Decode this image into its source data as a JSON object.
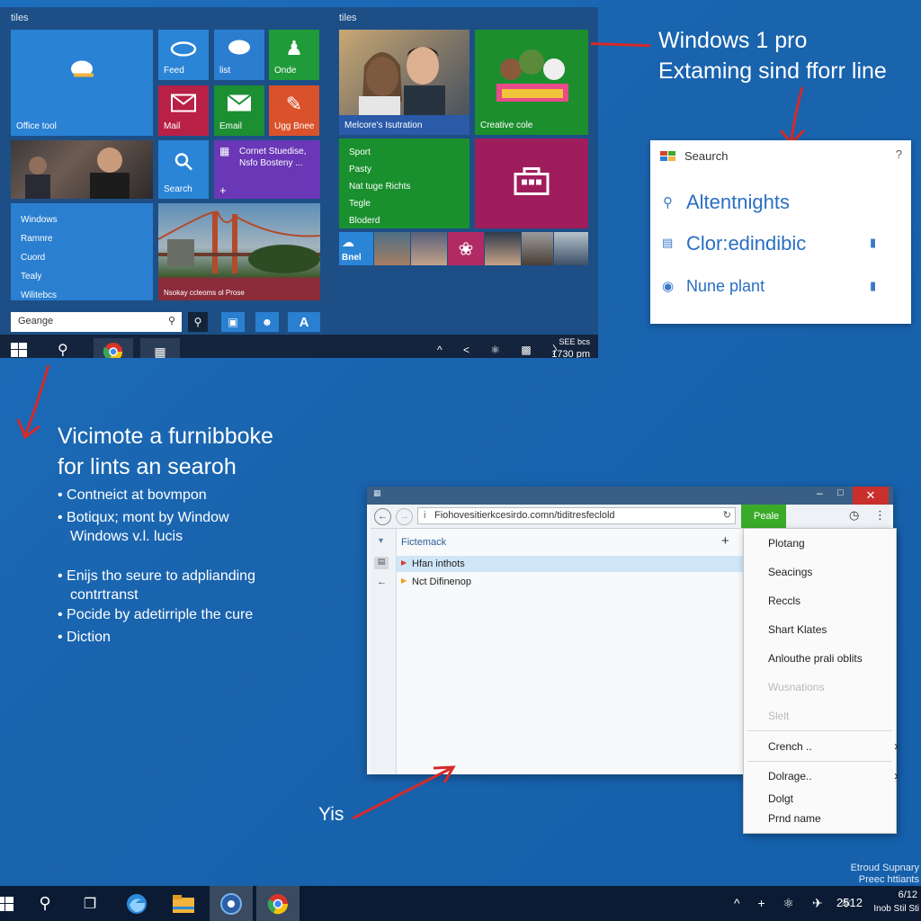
{
  "start": {
    "header_left": "tiles",
    "header_right": "tiles",
    "tiles": {
      "office": "Office tool",
      "feed": "Feed",
      "list": "list",
      "onde": "Onde",
      "mail": "Mail",
      "email": "Email",
      "news": "Ugg Bnee",
      "search": "Search",
      "people_title": "Cornet Stuedise,",
      "people_sub": "Nsfo Bosteny ...",
      "photos": "Nsokay ccleoms ol Prose",
      "movies": "Melcore's Isutration",
      "games": "Creative cole",
      "weather": "Bnel",
      "left_list": [
        "Windows",
        "Ramnre",
        "Cuord",
        "Tealy",
        "Wilitebcs"
      ],
      "green_list": [
        "Sport",
        "Pasty",
        "Nat tuge Richts",
        "Tegle",
        "Bloderd"
      ]
    },
    "search_value": "Geange",
    "clock": "SEE bcs",
    "time": "1730 pm"
  },
  "note_top": [
    "Windows 1 pro",
    "Extaming sind fforr line"
  ],
  "search_popup": {
    "title": "Seaurch",
    "help": "?",
    "results": [
      "Altentnights",
      "Clor:edindibic",
      "Nune plant"
    ]
  },
  "note_left": {
    "title": [
      "Vicimote a furnibboke",
      "for lints an searoh"
    ],
    "bullets": [
      "Contneict at bovmpon",
      "Botiqux; mont by Window Windows v.l. lucis",
      "Enijs tho seure to adplianding contrtranst",
      "Pocide by adetirriple the cure",
      "Diction"
    ]
  },
  "browser": {
    "url": "Fiohovesitierkcesirdo.comn/tiditresfeclold",
    "go_button": "Peale",
    "sidebar_title": "Fictemack",
    "items": [
      "Hfan inthots",
      "Nct Difinenop"
    ],
    "menu": [
      {
        "label": "Plotang",
        "disabled": false,
        "arrow": false
      },
      {
        "label": "Seacings",
        "disabled": false,
        "arrow": false
      },
      {
        "label": "Reccls",
        "disabled": false,
        "arrow": false
      },
      {
        "label": "Shart Klates",
        "disabled": false,
        "arrow": false
      },
      {
        "label": "Anlouthe prali oblits",
        "disabled": false,
        "arrow": false
      },
      {
        "label": "Wusnations",
        "disabled": true,
        "arrow": false
      },
      {
        "label": "Slelt",
        "disabled": true,
        "arrow": false
      },
      {
        "label": "Crench ..",
        "disabled": false,
        "arrow": true
      },
      {
        "label": "Dolrage..",
        "disabled": false,
        "arrow": true
      },
      {
        "label": "Dolgt",
        "disabled": false,
        "arrow": false
      },
      {
        "label": "Prnd name",
        "disabled": false,
        "arrow": false
      }
    ]
  },
  "yis": "Yis",
  "corner_text": [
    "Etroud Supnary",
    "Preec httiants"
  ],
  "taskbar": {
    "time": "2512",
    "date": "6/12",
    "date2": "Inob Stil Sti"
  },
  "colors": {
    "desktop": "#1a63ad",
    "accent_green": "#3aab29",
    "close_red": "#c9302c",
    "annotation_red": "#d62a2a"
  }
}
